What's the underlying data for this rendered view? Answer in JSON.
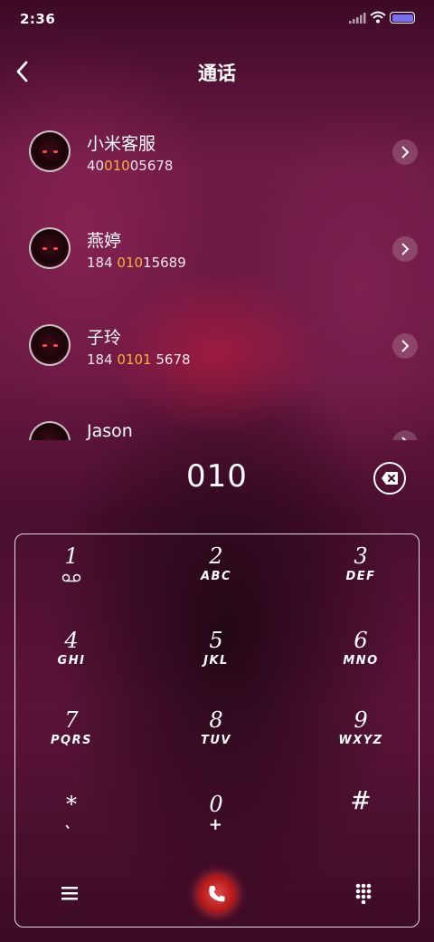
{
  "status": {
    "time": "2:36"
  },
  "header": {
    "title": "通话"
  },
  "contacts": [
    {
      "name": "小米客服",
      "num_pre": "40",
      "num_hl": "010",
      "num_post": "05678"
    },
    {
      "name": "燕婷",
      "num_pre": "184 ",
      "num_hl": "010",
      "num_post": "15689"
    },
    {
      "name": "子玲",
      "num_pre": "184 ",
      "num_hl": "0101",
      "num_post": " 5678"
    },
    {
      "name": "Jason",
      "num_pre": "",
      "num_hl": "",
      "num_post": ""
    }
  ],
  "input": {
    "digits": "010"
  },
  "keypad": [
    {
      "digit": "1",
      "letters": ""
    },
    {
      "digit": "2",
      "letters": "ABC"
    },
    {
      "digit": "3",
      "letters": "DEF"
    },
    {
      "digit": "4",
      "letters": "GHI"
    },
    {
      "digit": "5",
      "letters": "JKL"
    },
    {
      "digit": "6",
      "letters": "MNO"
    },
    {
      "digit": "7",
      "letters": "PQRS"
    },
    {
      "digit": "8",
      "letters": "TUV"
    },
    {
      "digit": "9",
      "letters": "WXYZ"
    },
    {
      "digit": "*",
      "letters": "、"
    },
    {
      "digit": "0",
      "letters": "+"
    },
    {
      "digit": "#",
      "letters": ""
    }
  ],
  "icons": {
    "back": "chevron-left-icon",
    "delete": "backspace-icon",
    "menu": "menu-icon",
    "call": "phone-icon",
    "keypad": "keypad-icon",
    "voicemail": "voicemail-icon"
  },
  "colors": {
    "highlight": "#f4b43a",
    "battery": "#7a6ff0",
    "call": "#d32f2f"
  }
}
